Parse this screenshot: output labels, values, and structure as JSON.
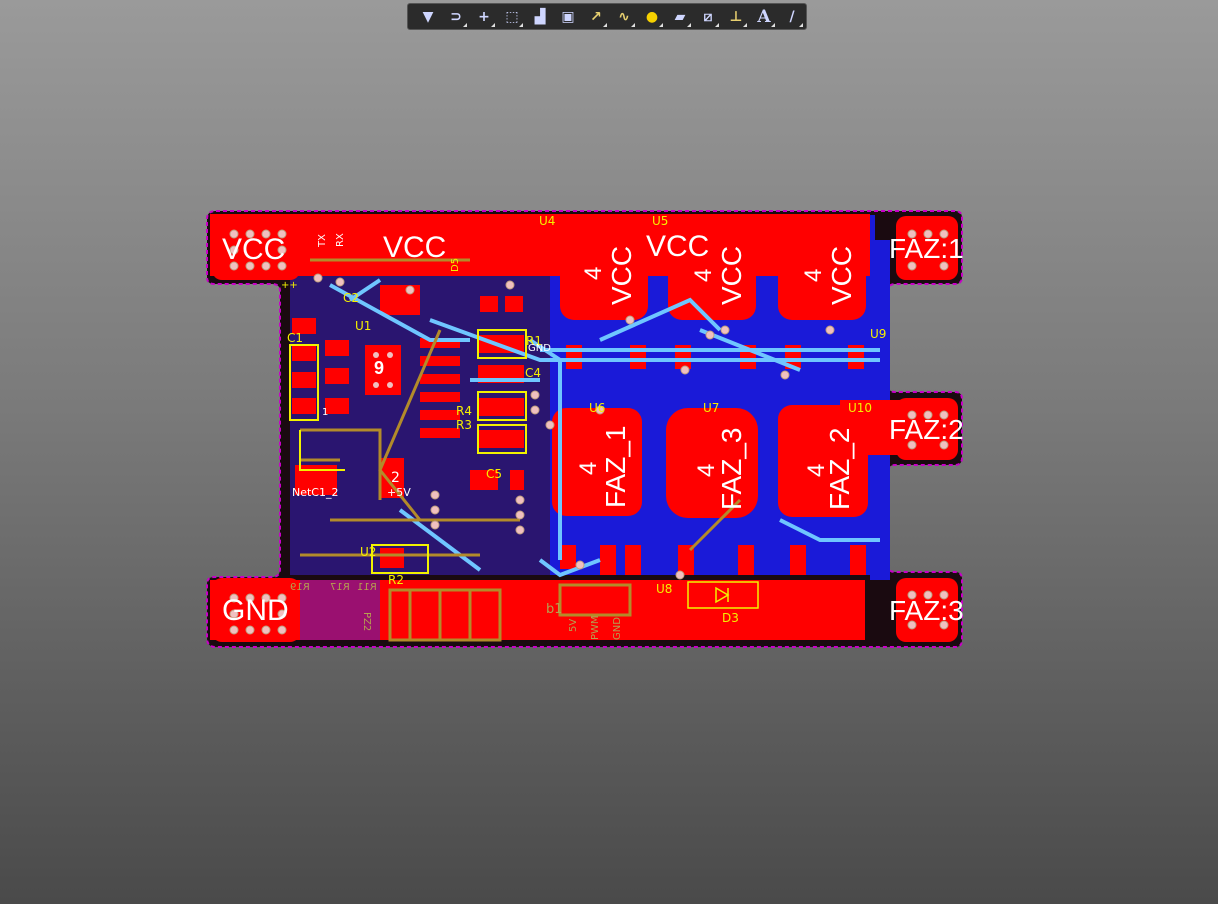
{
  "toolbar": {
    "tools": [
      {
        "name": "filter-icon",
        "glyph": "▼"
      },
      {
        "name": "route-tool-icon",
        "glyph": "⊃"
      },
      {
        "name": "crosshair-icon",
        "glyph": "+"
      },
      {
        "name": "select-rect-icon",
        "glyph": "⬚"
      },
      {
        "name": "align-icon",
        "glyph": "▟"
      },
      {
        "name": "component-icon",
        "glyph": "▣"
      },
      {
        "name": "interactive-route-icon",
        "glyph": "↗"
      },
      {
        "name": "diff-pair-icon",
        "glyph": "∿"
      },
      {
        "name": "via-icon",
        "glyph": "●"
      },
      {
        "name": "polygon-pour-icon",
        "glyph": "▰"
      },
      {
        "name": "keepout-icon",
        "glyph": "⧄"
      },
      {
        "name": "dimension-icon",
        "glyph": "⊥"
      },
      {
        "name": "text-icon",
        "glyph": "A"
      },
      {
        "name": "line-icon",
        "glyph": "/"
      }
    ]
  },
  "board": {
    "labels": {
      "vcc_left": "VCC",
      "vcc_mid1": "VCC",
      "vcc_mid2": "VCC",
      "gnd": "GND",
      "faz1": "FAZ:1",
      "faz2": "FAZ:2",
      "faz3": "FAZ:3",
      "vcc_pad": "VCC",
      "gnd_pad": "GND"
    },
    "vertical_labels": {
      "u4_vcc": "VCC",
      "u5_vcc": "VCC",
      "u9_vcc": "VCC",
      "u6_faz": "FAZ_1",
      "u7_faz": "FAZ_3",
      "u10_faz": "FAZ_2",
      "pin4_a": "4",
      "pin4_b": "4",
      "pin4_c": "4",
      "pin4_d": "4",
      "pin4_e": "4",
      "pin4_f": "4"
    },
    "refdes": {
      "u4": "U4",
      "u5": "U5",
      "u9": "U9",
      "u6": "U6",
      "u7": "U7",
      "u10": "U10",
      "c1": "C1",
      "c2": "C2",
      "u1": "U1",
      "c5": "C5",
      "r4": "R4",
      "r3": "R3",
      "u2": "U2",
      "d3": "D3",
      "u8": "U8",
      "r2": "R2",
      "c4": "C4",
      "r1": "R1"
    },
    "misc": {
      "gnd_small": "GND",
      "netc1": "NetC1_2",
      "plus5v": "+5V",
      "two": "2",
      "nine": "9",
      "tx": "TX",
      "rx": "RX",
      "v5": "5V",
      "pwm": "PWM",
      "gnd_v": "GND",
      "one": "1",
      "plusplus": "++",
      "r19": "R19",
      "r17": "R17",
      "r11": "R11",
      "pz2": "PZ2",
      "b1": "b1",
      "ds": "D5"
    }
  },
  "colors": {
    "top_copper": "#ff0000",
    "bottom_copper": "#1f1fff",
    "silkscreen": "#f2f200",
    "board_outline": "#c800c8",
    "track_light": "#6fc6ff",
    "olive": "#b38b2a"
  }
}
